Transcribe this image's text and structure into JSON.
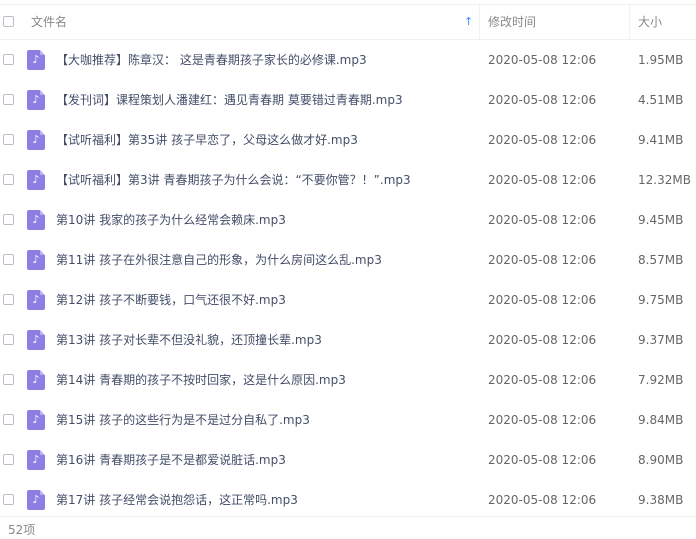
{
  "header": {
    "filename_label": "文件名",
    "sort_arrow": "↑",
    "modified_label": "修改时间",
    "size_label": "大小"
  },
  "files": [
    {
      "name": "【大咖推荐】陈章汉： 这是青春期孩子家长的必修课.mp3",
      "date": "2020-05-08 12:06",
      "size": "1.95MB"
    },
    {
      "name": "【发刊词】课程策划人潘建红：遇见青春期 莫要错过青春期.mp3",
      "date": "2020-05-08 12:06",
      "size": "4.51MB"
    },
    {
      "name": "【试听福利】第35讲 孩子早恋了，父母这么做才好.mp3",
      "date": "2020-05-08 12:06",
      "size": "9.41MB"
    },
    {
      "name": "【试听福利】第3讲 青春期孩子为什么会说：“不要你管？！”.mp3",
      "date": "2020-05-08 12:06",
      "size": "12.32MB"
    },
    {
      "name": "第10讲 我家的孩子为什么经常会赖床.mp3",
      "date": "2020-05-08 12:06",
      "size": "9.45MB"
    },
    {
      "name": "第11讲 孩子在外很注意自己的形象，为什么房间这么乱.mp3",
      "date": "2020-05-08 12:06",
      "size": "8.57MB"
    },
    {
      "name": "第12讲 孩子不断要钱，口气还很不好.mp3",
      "date": "2020-05-08 12:06",
      "size": "9.75MB"
    },
    {
      "name": "第13讲 孩子对长辈不但没礼貌，还顶撞长辈.mp3",
      "date": "2020-05-08 12:06",
      "size": "9.37MB"
    },
    {
      "name": "第14讲 青春期的孩子不按时回家，这是什么原因.mp3",
      "date": "2020-05-08 12:06",
      "size": "7.92MB"
    },
    {
      "name": "第15讲 孩子的这些行为是不是过分自私了.mp3",
      "date": "2020-05-08 12:06",
      "size": "9.84MB"
    },
    {
      "name": "第16讲 青春期孩子是不是都爱说脏话.mp3",
      "date": "2020-05-08 12:06",
      "size": "8.90MB"
    },
    {
      "name": "第17讲 孩子经常会说抱怨话，这正常吗.mp3",
      "date": "2020-05-08 12:06",
      "size": "9.38MB"
    }
  ],
  "footer": {
    "item_count": "52项"
  },
  "icons": {
    "file": "music-file-icon",
    "note_glyph": "♪"
  },
  "colors": {
    "accent": "#3b8cff",
    "file_icon": "#8c7ee3"
  }
}
